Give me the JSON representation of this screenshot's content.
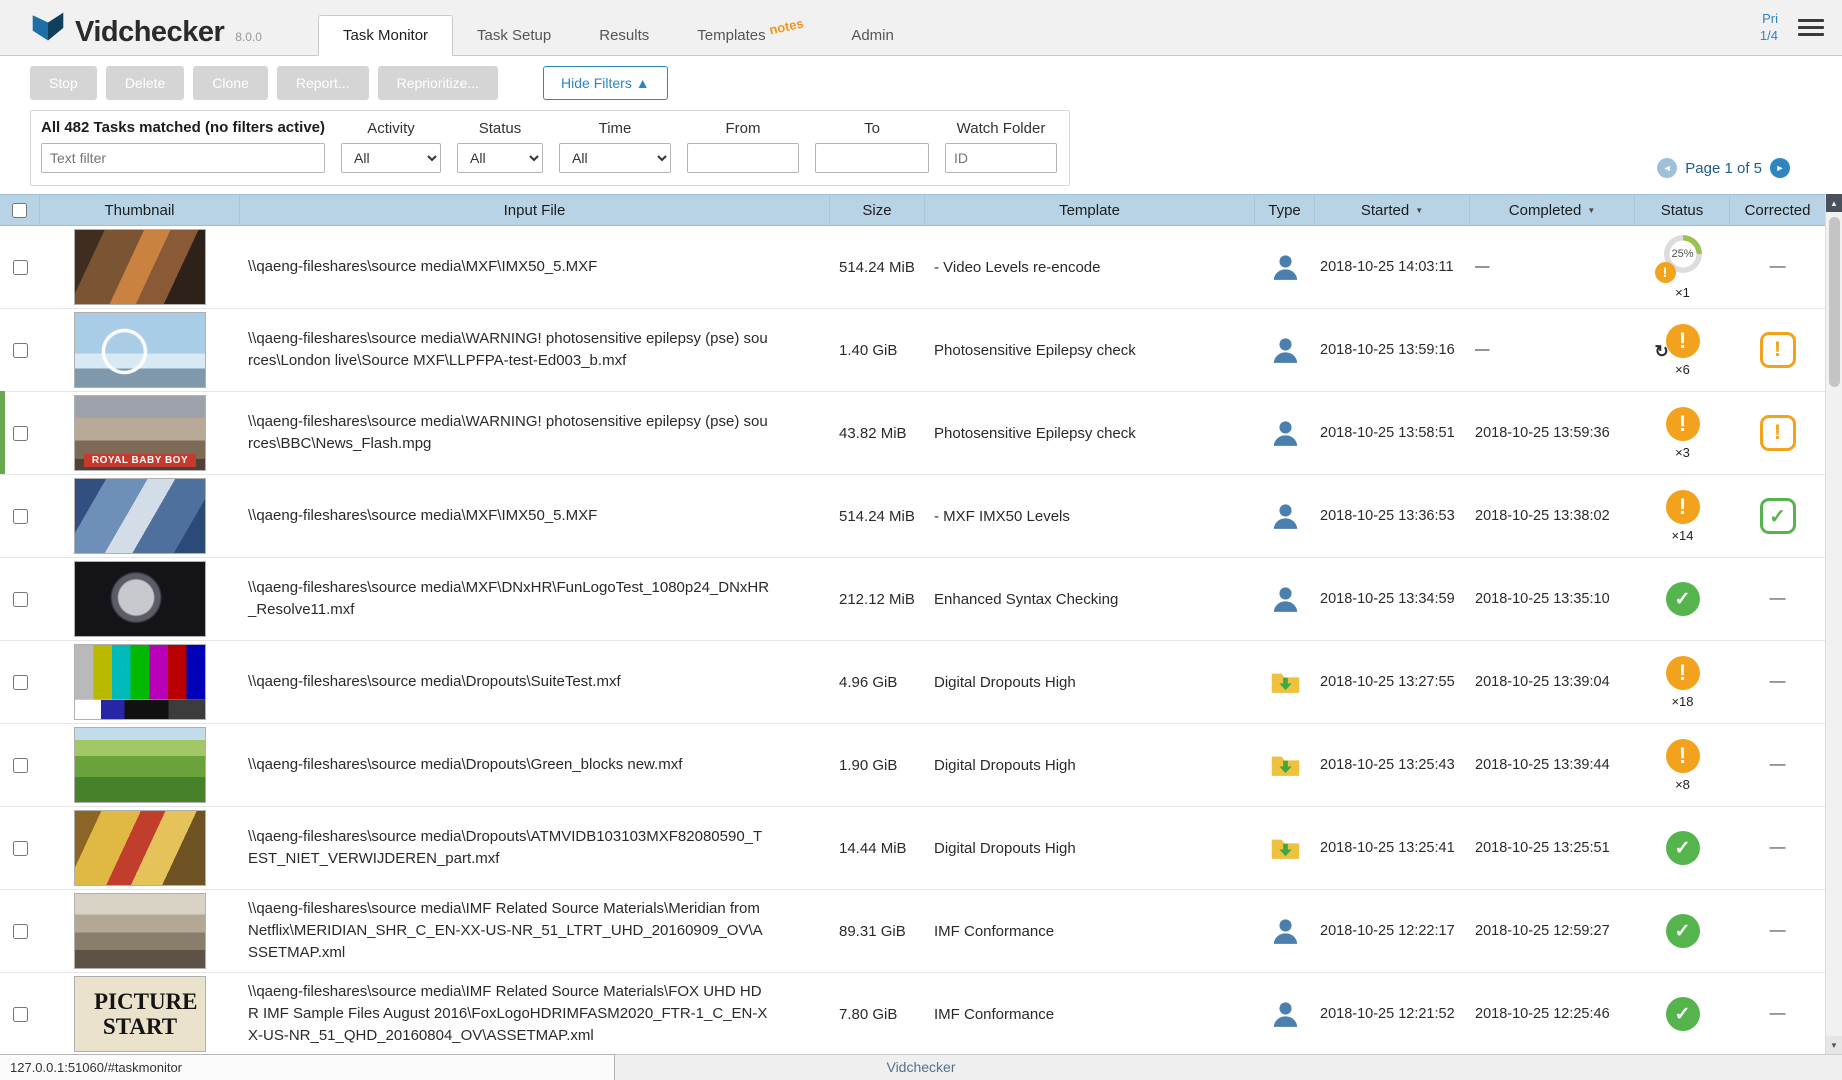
{
  "app": {
    "name": "Vidchecker",
    "version": "8.0.0",
    "pri_label": "Pri",
    "pri_value": "1/4"
  },
  "nav": {
    "tabs": [
      {
        "label": "Task Monitor"
      },
      {
        "label": "Task Setup"
      },
      {
        "label": "Results"
      },
      {
        "label": "Templates",
        "badge": "notes"
      },
      {
        "label": "Admin"
      }
    ]
  },
  "toolbar": {
    "buttons": [
      "Stop",
      "Delete",
      "Clone",
      "Report...",
      "Reprioritize..."
    ],
    "hide_filters_label": "Hide Filters ▲"
  },
  "filters": {
    "summary": "All 482 Tasks matched (no filters active)",
    "text_placeholder": "Text filter",
    "activity_label": "Activity",
    "status_label": "Status",
    "time_label": "Time",
    "from_label": "From",
    "to_label": "To",
    "watch_folder_label": "Watch Folder",
    "watch_placeholder": "ID",
    "all_option": "All",
    "page_indicator": "Page 1 of 5"
  },
  "icons": {
    "warning": "!",
    "check": "✓",
    "spinner": "↻",
    "sort": "▼",
    "prev": "◄",
    "next": "►",
    "up": "▲",
    "down": "▼",
    "dash": "—"
  },
  "colors": {
    "accent_blue": "#2e86c1",
    "table_header_blue": "#b9d3e6",
    "warning_orange": "#f2a21c",
    "success_green": "#55b54c",
    "notes_orange": "#f5941d",
    "selected_row_green": "#6aa84f"
  },
  "table": {
    "headers": [
      "Thumbnail",
      "Input File",
      "Size",
      "Template",
      "Type",
      "Started",
      "Completed",
      "Status",
      "Corrected"
    ],
    "rows": [
      {
        "thumb": "control-room",
        "thumb_text": "",
        "input_file": "\\\\qaeng-fileshares\\source media\\MXF\\IMX50_5.MXF",
        "size": "514.24 MiB",
        "template": "- Video Levels re-encode",
        "type_icon": "user",
        "started": "2018-10-25 14:03:11",
        "completed": "—",
        "status_kind": "progress",
        "status_progress": "25%",
        "status_count": "×1",
        "corrected_kind": "none",
        "selected": false
      },
      {
        "thumb": "ferris-wheel",
        "thumb_text": "",
        "input_file": "\\\\qaeng-fileshares\\source media\\WARNING! photosensitive epilepsy (pse) sources\\London live\\Source MXF\\LLPFPA-test-Ed003_b.mxf",
        "size": "1.40 GiB",
        "template": "Photosensitive Epilepsy check",
        "type_icon": "user",
        "started": "2018-10-25 13:59:16",
        "completed": "—",
        "status_kind": "warn-running",
        "status_progress": "",
        "status_count": "×6",
        "corrected_kind": "warn",
        "selected": false
      },
      {
        "thumb": "street-banner",
        "thumb_text": "ROYAL BABY BOY",
        "input_file": "\\\\qaeng-fileshares\\source media\\WARNING! photosensitive epilepsy (pse) sources\\BBC\\News_Flash.mpg",
        "size": "43.82 MiB",
        "template": "Photosensitive Epilepsy check",
        "type_icon": "user",
        "started": "2018-10-25 13:58:51",
        "completed": "2018-10-25 13:59:36",
        "status_kind": "warn",
        "status_progress": "",
        "status_count": "×3",
        "corrected_kind": "warn",
        "selected": true
      },
      {
        "thumb": "crowd-blue",
        "thumb_text": "",
        "input_file": "\\\\qaeng-fileshares\\source media\\MXF\\IMX50_5.MXF",
        "size": "514.24 MiB",
        "template": "- MXF IMX50 Levels",
        "type_icon": "user",
        "started": "2018-10-25 13:36:53",
        "completed": "2018-10-25 13:38:02",
        "status_kind": "warn",
        "status_progress": "",
        "status_count": "×14",
        "corrected_kind": "ok",
        "selected": false
      },
      {
        "thumb": "moon-dark",
        "thumb_text": "",
        "input_file": "\\\\qaeng-fileshares\\source media\\MXF\\DNxHR\\FunLogoTest_1080p24_DNxHR_Resolve11.mxf",
        "size": "212.12 MiB",
        "template": "Enhanced Syntax Checking",
        "type_icon": "user",
        "started": "2018-10-25 13:34:59",
        "completed": "2018-10-25 13:35:10",
        "status_kind": "ok",
        "status_progress": "",
        "status_count": "",
        "corrected_kind": "none",
        "selected": false
      },
      {
        "thumb": "color-bars",
        "thumb_text": "",
        "input_file": "\\\\qaeng-fileshares\\source media\\Dropouts\\SuiteTest.mxf",
        "size": "4.96 GiB",
        "template": "Digital Dropouts High",
        "type_icon": "folder",
        "started": "2018-10-25 13:27:55",
        "completed": "2018-10-25 13:39:04",
        "status_kind": "warn",
        "status_progress": "",
        "status_count": "×18",
        "corrected_kind": "none",
        "selected": false
      },
      {
        "thumb": "landscape",
        "thumb_text": "",
        "input_file": "\\\\qaeng-fileshares\\source media\\Dropouts\\Green_blocks new.mxf",
        "size": "1.90 GiB",
        "template": "Digital Dropouts High",
        "type_icon": "folder",
        "started": "2018-10-25 13:25:43",
        "completed": "2018-10-25 13:39:44",
        "status_kind": "warn",
        "status_progress": "",
        "status_count": "×8",
        "corrected_kind": "none",
        "selected": false
      },
      {
        "thumb": "crowd-yellow",
        "thumb_text": "",
        "input_file": "\\\\qaeng-fileshares\\source media\\Dropouts\\ATMVIDB103103MXF82080590_TEST_NIET_VERWIJDEREN_part.mxf",
        "size": "14.44 MiB",
        "template": "Digital Dropouts High",
        "type_icon": "folder",
        "started": "2018-10-25 13:25:41",
        "completed": "2018-10-25 13:25:51",
        "status_kind": "ok",
        "status_progress": "",
        "status_count": "",
        "corrected_kind": "none",
        "selected": false
      },
      {
        "thumb": "street-tram",
        "thumb_text": "",
        "input_file": "\\\\qaeng-fileshares\\source media\\IMF Related Source Materials\\Meridian from Netflix\\MERIDIAN_SHR_C_EN-XX-US-NR_51_LTRT_UHD_20160909_OV\\ASSETMAP.xml",
        "size": "89.31 GiB",
        "template": "IMF Conformance",
        "type_icon": "user",
        "started": "2018-10-25 12:22:17",
        "completed": "2018-10-25 12:59:27",
        "status_kind": "ok",
        "status_progress": "",
        "status_count": "",
        "corrected_kind": "none",
        "selected": false
      },
      {
        "thumb": "picture-start",
        "thumb_text": "PICTURE START",
        "input_file": "\\\\qaeng-fileshares\\source media\\IMF Related Source Materials\\FOX UHD HDR IMF Sample Files August 2016\\FoxLogoHDRIMFASM2020_FTR-1_C_EN-XX-US-NR_51_QHD_20160804_OV\\ASSETMAP.xml",
        "size": "7.80 GiB",
        "template": "IMF Conformance",
        "type_icon": "user",
        "started": "2018-10-25 12:21:52",
        "completed": "2018-10-25 12:25:46",
        "status_kind": "ok",
        "status_progress": "",
        "status_count": "",
        "corrected_kind": "none",
        "selected": false
      }
    ]
  },
  "footer": {
    "status_url": "127.0.0.1:51060/#taskmonitor",
    "brand": "Vidchecker"
  }
}
